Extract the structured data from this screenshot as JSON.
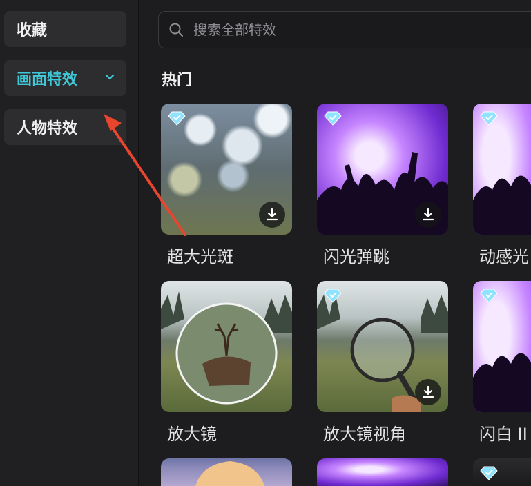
{
  "sidebar": {
    "items": [
      {
        "label": "收藏"
      },
      {
        "label": "画面特效"
      },
      {
        "label": "人物特效"
      }
    ]
  },
  "search": {
    "placeholder": "搜索全部特效"
  },
  "section": {
    "title": "热门"
  },
  "effects": [
    {
      "label": "超大光斑"
    },
    {
      "label": "闪光弹跳"
    },
    {
      "label": "动感光"
    },
    {
      "label": "放大镜"
    },
    {
      "label": "放大镜视角"
    },
    {
      "label": "闪白 II"
    }
  ],
  "colors": {
    "accent": "#3fc9d8",
    "arrow": "#e8452f",
    "background": "#1d1d1f",
    "panel": "#2d2d30"
  },
  "icons": [
    "search-icon",
    "chevron-down-icon",
    "diamond-icon",
    "download-icon"
  ]
}
